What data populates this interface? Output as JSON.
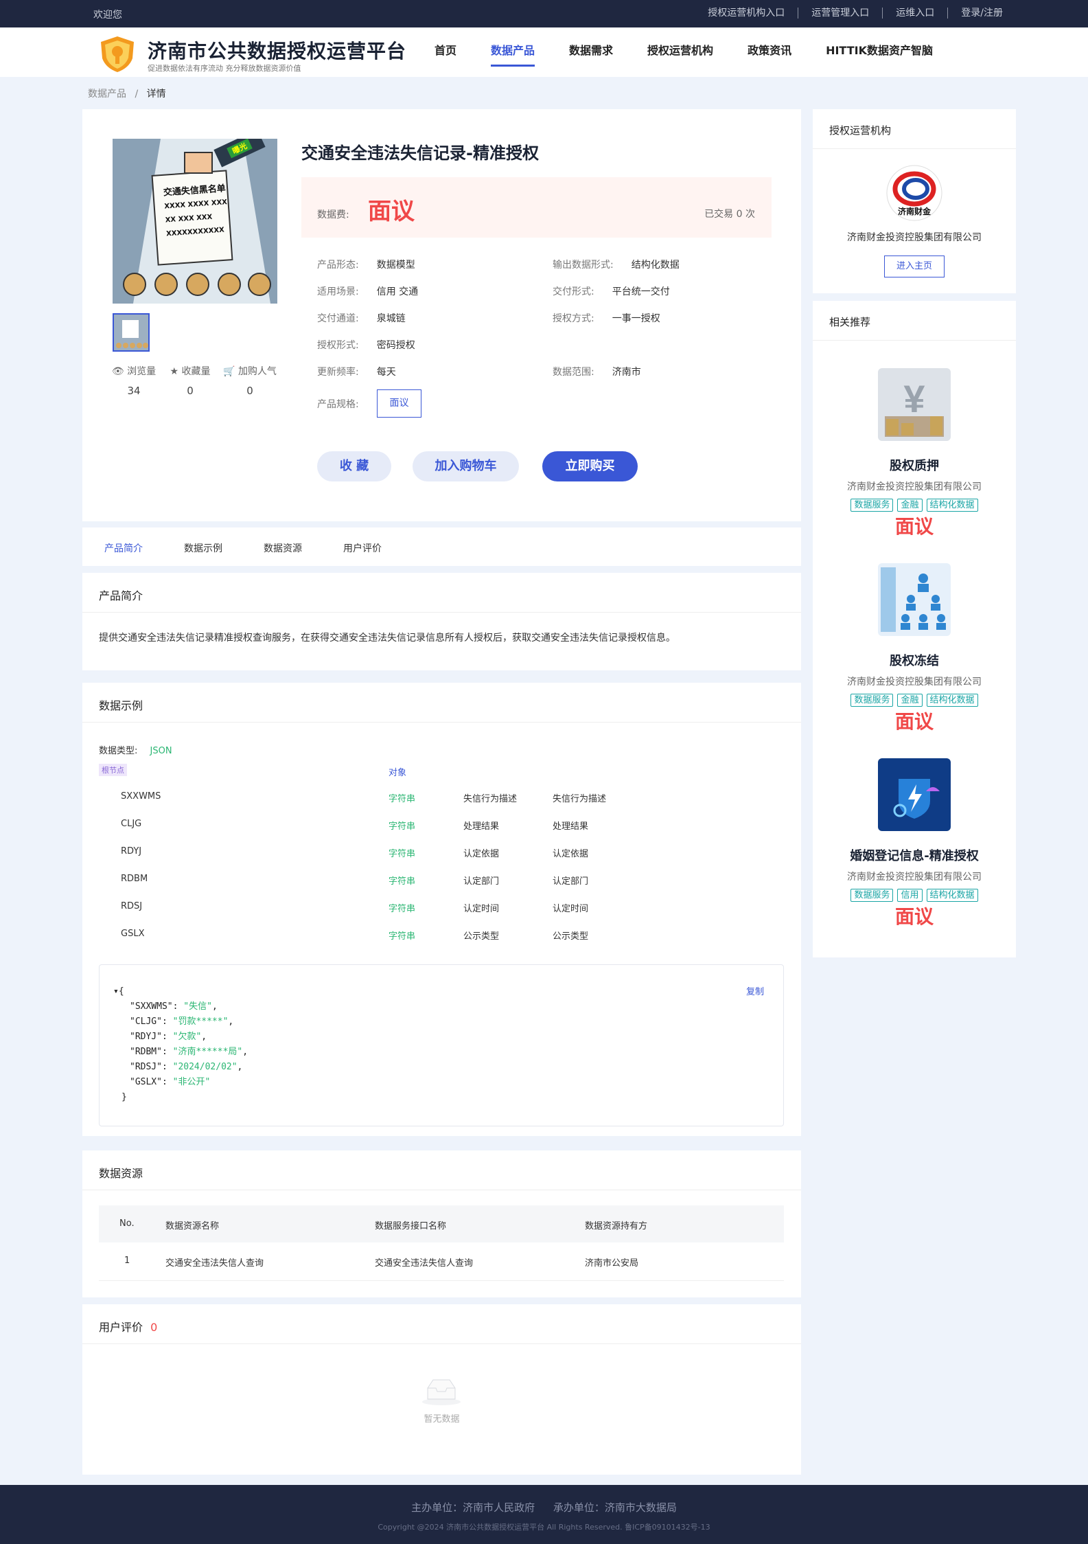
{
  "topbar": {
    "welcome": "欢迎您",
    "links": [
      "授权运营机构入口",
      "运营管理入口",
      "运维入口",
      "登录/注册"
    ]
  },
  "header": {
    "brand": "济南市公共数据授权运营平台",
    "slogan": "促进数据依法有序流动 充分释放数据资源价值",
    "nav": [
      "首页",
      "数据产品",
      "数据需求",
      "授权运营机构",
      "政策资讯",
      "HITTIK数据资产智脑"
    ],
    "nav_active": "数据产品"
  },
  "breadcrumb": {
    "parent": "数据产品",
    "sep": "/",
    "current": "详情"
  },
  "product": {
    "image_text": {
      "badge": "曝光",
      "board_title": "交通失信黑名单",
      "lines": [
        "XXXX XXXX XXX",
        "XX XXX XXX",
        "XXXXXXXXXXX"
      ]
    },
    "stats": [
      {
        "label": "浏览量",
        "value": "34",
        "icon": "eye-icon"
      },
      {
        "label": "收藏量",
        "value": "0",
        "icon": "star-icon"
      },
      {
        "label": "加购人气",
        "value": "0",
        "icon": "cart-icon"
      }
    ],
    "title": "交通安全违法失信记录-精准授权",
    "price_label": "数据费:",
    "price": "面议",
    "traded": "已交易 0 次",
    "attrs": [
      {
        "k": "产品形态:",
        "v": "数据模型"
      },
      {
        "k": "输出数据形式:",
        "v": "结构化数据"
      },
      {
        "k": "适用场景:",
        "v": "信用  交通"
      },
      {
        "k": "交付形式:",
        "v": "平台统一交付"
      },
      {
        "k": "交付通道:",
        "v": "泉城链"
      },
      {
        "k": "授权方式:",
        "v": "一事一授权"
      },
      {
        "k": "授权形式:",
        "v": "密码授权"
      },
      {
        "k": "更新频率:",
        "v": "每天"
      },
      {
        "k": "数据范围:",
        "v": "济南市"
      }
    ],
    "spec_label": "产品规格:",
    "spec_value": "面议",
    "buttons": {
      "fav": "收 藏",
      "cart": "加入购物车",
      "buy": "立即购买"
    }
  },
  "tabs": [
    "产品简介",
    "数据示例",
    "数据资源",
    "用户评价"
  ],
  "intro": {
    "title": "产品简介",
    "text": "提供交通安全违法失信记录精准授权查询服务，在获得交通安全违法失信记录信息所有人授权后，获取交通安全违法失信记录授权信息。"
  },
  "sample": {
    "title": "数据示例",
    "type_label": "数据类型:",
    "type_value": "JSON",
    "root_tag": "根节点",
    "root_type": "对象",
    "fields": [
      {
        "name": "SXXWMS",
        "type": "字符串",
        "desc": "失信行为描述",
        "label": "失信行为描述"
      },
      {
        "name": "CLJG",
        "type": "字符串",
        "desc": "处理结果",
        "label": "处理结果"
      },
      {
        "name": "RDYJ",
        "type": "字符串",
        "desc": "认定依据",
        "label": "认定依据"
      },
      {
        "name": "RDBM",
        "type": "字符串",
        "desc": "认定部门",
        "label": "认定部门"
      },
      {
        "name": "RDSJ",
        "type": "字符串",
        "desc": "认定时间",
        "label": "认定时间"
      },
      {
        "name": "GSLX",
        "type": "字符串",
        "desc": "公示类型",
        "label": "公示类型"
      }
    ],
    "copy": "复制",
    "json": [
      {
        "k": "\"SXXWMS\"",
        "v": "\"失信\""
      },
      {
        "k": "\"CLJG\"",
        "v": "\"罚款*****\""
      },
      {
        "k": "\"RDYJ\"",
        "v": "\"欠款\""
      },
      {
        "k": "\"RDBM\"",
        "v": "\"济南******局\""
      },
      {
        "k": "\"RDSJ\"",
        "v": "\"2024/02/02\""
      },
      {
        "k": "\"GSLX\"",
        "v": "\"非公开\""
      }
    ]
  },
  "resources": {
    "title": "数据资源",
    "headers": [
      "No.",
      "数据资源名称",
      "数据服务接口名称",
      "数据资源持有方"
    ],
    "rows": [
      [
        "1",
        "交通安全违法失信人查询",
        "交通安全违法失信人查询",
        "济南市公安局"
      ]
    ]
  },
  "reviews": {
    "title": "用户评价",
    "count": "0",
    "empty": "暂无数据"
  },
  "org": {
    "title": "授权运营机构",
    "name": "济南财金投资控股集团有限公司",
    "logo_text": "济南财金",
    "button": "进入主页"
  },
  "recommend": {
    "title": "相关推荐",
    "items": [
      {
        "name": "股权质押",
        "org": "济南财金投资控股集团有限公司",
        "tags": [
          "数据服务",
          "金融",
          "结构化数据"
        ],
        "price": "面议",
        "icon": "yen-coins-icon"
      },
      {
        "name": "股权冻结",
        "org": "济南财金投资控股集团有限公司",
        "tags": [
          "数据服务",
          "金融",
          "结构化数据"
        ],
        "price": "面议",
        "icon": "org-chart-icon"
      },
      {
        "name": "婚姻登记信息-精准授权",
        "org": "济南财金投资控股集团有限公司",
        "tags": [
          "数据服务",
          "信用",
          "结构化数据"
        ],
        "price": "面议",
        "icon": "shield-lock-icon"
      }
    ]
  },
  "footer": {
    "host": "主办单位：济南市人民政府",
    "undertake": "承办单位：济南市大数据局",
    "copyright": "Copyright @2024 济南市公共数据授权运营平台 All Rights Reserved. 鲁ICP备09101432号-13"
  },
  "colors": {
    "accent": "#3a57d6",
    "price": "#f04848",
    "dark": "#1f2740",
    "tag": "#1aa5a5",
    "string": "#2bb673"
  }
}
